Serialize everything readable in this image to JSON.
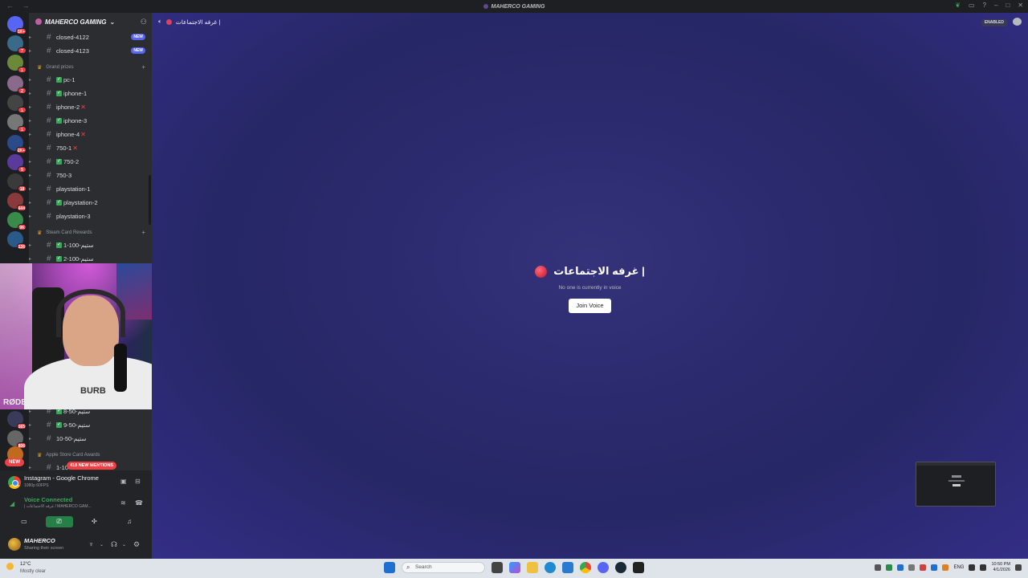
{
  "window": {
    "title": "MAHERCO GAMING",
    "nav": "← →"
  },
  "rail": {
    "badges": [
      "1K+",
      "7",
      "1",
      "2",
      "1",
      "1",
      "2K+",
      "5",
      "18",
      "644",
      "9K",
      "136",
      "165",
      "806"
    ],
    "new_label": "NEW"
  },
  "sidebar": {
    "guild_name": "MAHERCO GAMING",
    "channels_top": [
      {
        "name": "closed-4122",
        "tag": "NEW"
      },
      {
        "name": "closed-4123",
        "tag": "NEW"
      }
    ],
    "category_grand": "Grand prizes",
    "grand_channels": [
      {
        "name": "pc-1",
        "check": true,
        "cross": false
      },
      {
        "name": "iphone-1",
        "check": true,
        "cross": false
      },
      {
        "name": "iphone-2",
        "check": false,
        "cross": true
      },
      {
        "name": "iphone-3",
        "check": true,
        "cross": false
      },
      {
        "name": "iphone-4",
        "check": false,
        "cross": true
      },
      {
        "name": "750-1",
        "check": false,
        "cross": true
      },
      {
        "name": "750-2",
        "check": true,
        "cross": false
      },
      {
        "name": "750-3",
        "check": false,
        "cross": false
      },
      {
        "name": "playstation-1",
        "check": false,
        "cross": false
      },
      {
        "name": "playstation-2",
        "check": true,
        "cross": false
      },
      {
        "name": "playstation-3",
        "check": false,
        "cross": false
      }
    ],
    "category_steam": "Steam Card Rewards",
    "steam_channels": [
      {
        "name": "1-100-ستيم",
        "check": true
      },
      {
        "name": "2-100-ستيم",
        "check": true
      }
    ],
    "lower_channels": [
      {
        "name": "8-50-ستيم",
        "check": true
      },
      {
        "name": "9-50-ستيم",
        "check": true
      },
      {
        "name": "10-50-ستيم",
        "check": false
      }
    ],
    "category_apple": "Apple Store Card Awards",
    "apple_channel": "1-10",
    "mentions_pill": "418 NEW MENTIONS"
  },
  "webcam": {
    "shirt_text": "BURB",
    "mic_brand": "RØDE"
  },
  "panel": {
    "stream_title": "Instagram - Google Chrome",
    "stream_sub": "1080p 60FPS",
    "voice_status": "Voice Connected",
    "voice_channel": "| غرفه الاجتماعات / MAHERCO GAM...",
    "username": "MAHERCO",
    "user_status": "Sharing their screen"
  },
  "main": {
    "header_channel": "غرفه الاجتماعات |",
    "enabled_badge": "ENABLED",
    "voice_title": "غرفه الاجتماعات |",
    "voice_empty": "No one is currently in voice",
    "join_button": "Join Voice"
  },
  "taskbar": {
    "temp": "12°C",
    "weather": "Mostly clear",
    "search_placeholder": "Search",
    "lang": "ENG",
    "time": "10:50 PM",
    "date": "4/1/2026"
  },
  "colors": {
    "accent": "#5865f2",
    "danger": "#f23f43",
    "success": "#3ba55c",
    "main_bg": "#2b2a6e"
  }
}
